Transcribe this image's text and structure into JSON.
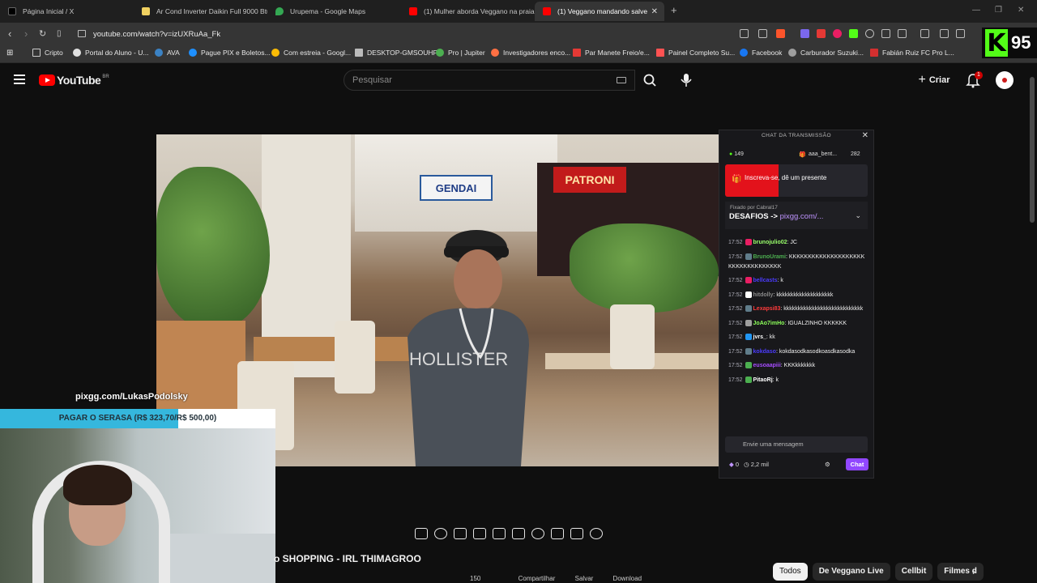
{
  "browser": {
    "tabs": [
      {
        "label": "Página Inicial / X",
        "icon": "x-logo-icon",
        "color": "#000000"
      },
      {
        "label": "Ar Cond Inverter Daikin Full 9000 Btu",
        "icon": "product-icon",
        "color": "#f0d060"
      },
      {
        "label": "Urupema - Google Maps",
        "icon": "maps-icon",
        "color": "#34a853"
      },
      {
        "label": "(1) Mulher aborda Veggano na praia",
        "icon": "youtube-icon",
        "color": "#ff0000"
      },
      {
        "label": "(1) Veggano mandando salve",
        "icon": "youtube-icon",
        "color": "#ff0000"
      }
    ],
    "new_tab": "+",
    "url": "youtube.com/watch?v=izUXRuAa_Fk",
    "bookmarks": [
      {
        "label": "Cripto",
        "color": "#888888"
      },
      {
        "label": "Portal do Aluno - U...",
        "color": "#e0e0e0"
      },
      {
        "label": "AVA",
        "color": "#3b82c4"
      },
      {
        "label": "Pague PIX e Boletos...",
        "color": "#1e90ff"
      },
      {
        "label": "Com estreia - Googl...",
        "color": "#fbbc05"
      },
      {
        "label": "DESKTOP-GMSOUHF",
        "color": "#bbbbbb"
      },
      {
        "label": "Pro | Jupiter",
        "color": "#4caf50"
      },
      {
        "label": "Investigadores enco...",
        "color": "#ff7043"
      },
      {
        "label": "Par Manete Freio/e...",
        "color": "#e53935"
      },
      {
        "label": "Painel Completo Su...",
        "color": "#ff5252"
      },
      {
        "label": "Facebook",
        "color": "#1877f2"
      },
      {
        "label": "Carburador Suzuki...",
        "color": "#9e9e9e"
      },
      {
        "label": "Fabián Ruiz FC Pro L...",
        "color": "#d32f2f"
      }
    ],
    "kick_badge": {
      "letter": "K",
      "count": "95",
      "color": "#53fc18"
    }
  },
  "youtube": {
    "logo_word": "YouTube",
    "country": "BR",
    "search_placeholder": "Pesquisar",
    "create_label": "Criar",
    "notification_count": "1",
    "video_title": "o SHOPPING - IRL THIMAGROO",
    "actions": [
      "150",
      "",
      "Compartilhar",
      "Salvar",
      "Download"
    ],
    "chips": [
      "Todos",
      "De Veggano Live",
      "Cellbit",
      "Filmes d"
    ],
    "colors": {
      "brand_red": "#ff0000",
      "bg": "#0f0f0f"
    }
  },
  "video_scene": {
    "sign_left": "GENDAI",
    "sign_right": "PATRONI",
    "shirt_text": "HOLLISTER"
  },
  "live_chat": {
    "header": "CHAT DA TRANSMISSÃO",
    "viewers": "149",
    "top_user": "aaa_bent...",
    "top_count": "282",
    "subscribe_text": "Inscreva-se, dê um presente",
    "pinned_by": "Fixado por Cabral17",
    "pinned_message": "DESAFIOS ->",
    "pinned_link": "pixgg.com/...",
    "messages": [
      {
        "time": "17:52",
        "user": "brunojulio02",
        "text": "JC",
        "color": "#9aff6b",
        "badge": "#e91e63"
      },
      {
        "time": "17:52",
        "user": "BrunoUrami",
        "text": "KKKKKKKKKKKKKKKKKKKKKKKKKKKKKKKKKK",
        "color": "#4caf50",
        "badge": "#607d8b"
      },
      {
        "time": "17:52",
        "user": "bellcasts",
        "text": "k",
        "color": "#4b3cff",
        "badge": "#e91e63"
      },
      {
        "time": "17:52",
        "user": "hitdolly",
        "text": "kkkkkkkkkkkkkkkkkkkk",
        "color": "#8a8a8a",
        "badge": "#ffffff"
      },
      {
        "time": "17:52",
        "user": "Lexapsi83",
        "text": "kkkkkkkkkkkkkkkkkkkkkkkkkkkk",
        "color": "#ff3b3b",
        "badge": "#607d8b"
      },
      {
        "time": "17:52",
        "user": "JoAo7imHo",
        "text": "IGUALZINHO KKKKKK",
        "color": "#8cff5a",
        "badge": "#9e9e9e"
      },
      {
        "time": "17:52",
        "user": "jvrs_",
        "text": "kk",
        "color": "#ffffff",
        "badge": "#2196f3"
      },
      {
        "time": "17:52",
        "user": "kokdaso",
        "text": "kokdasodkasodkoasdkasodka",
        "color": "#4b3cff",
        "badge": "#607d8b"
      },
      {
        "time": "17:52",
        "user": "eusoaapiii",
        "text": "KKKkkkkkkk",
        "color": "#a64dff",
        "badge": "#4caf50"
      },
      {
        "time": "17:52",
        "user": "PitaoRj",
        "text": "k",
        "color": "#ffffff",
        "badge": "#4caf50"
      }
    ],
    "input_placeholder": "Envie uma mensagem",
    "points": "0",
    "points_total": "2,2 mil",
    "chat_button": "Chat",
    "accent": "#9147ff"
  },
  "stream_overlay": {
    "pix_url": "pixgg.com/LukasPodolsky",
    "goal_text": "PAGAR O SERASA (R$ 323,70/R$ 500,00)",
    "goal_progress": 0.6474,
    "goal_color": "#35b7dd"
  }
}
